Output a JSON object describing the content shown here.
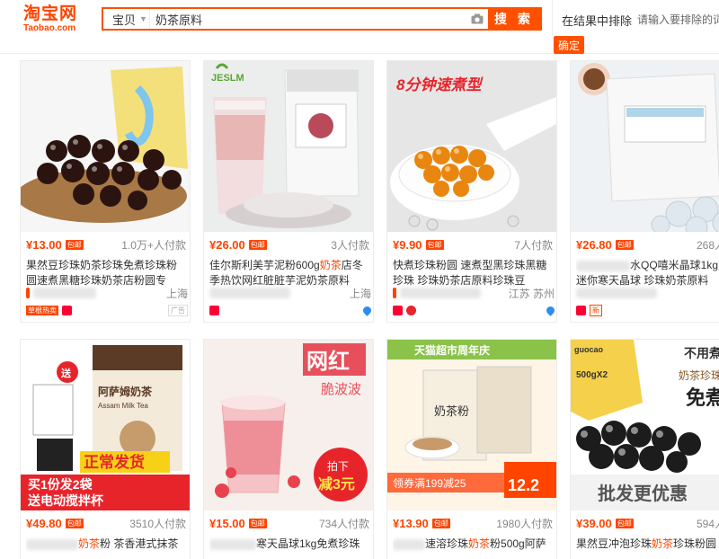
{
  "header": {
    "logo_cn": "淘宝网",
    "logo_en": "Taobao.com",
    "category_label": "宝贝",
    "search_value": "奶茶原料",
    "search_button": "搜 索",
    "exclude_label": "在结果中排除",
    "exclude_placeholder": "请输入要排除的词",
    "confirm_button": "确定"
  },
  "items": [
    {
      "price": "¥13.00",
      "baoyou": "包邮",
      "sales": "1.0万+人付款",
      "title_a": "果然豆珍珠奶茶珍珠免煮珍珠粉",
      "title_b": "圆速煮黑糖珍珠奶茶店粉圆专",
      "location": "上海",
      "tag": "草根热卖"
    },
    {
      "price": "¥26.00",
      "baoyou": "包邮",
      "sales": "3人付款",
      "title_a": "佳尔斯利美芋泥粉600g",
      "title_hl": "奶茶",
      "title_c": "店冬",
      "title_b": "季热饮网红脏脏芋泥奶茶原料",
      "location": "上海"
    },
    {
      "price": "¥9.90",
      "baoyou": "包邮",
      "sales": "7人付款",
      "title_a": "快煮珍珠粉圆 速煮型黑珍珠黑糖",
      "title_b": "珍珠 珍珠奶茶店原料珍珠豆",
      "location": "江苏 苏州",
      "image_text": "8分钟速煮型"
    },
    {
      "price": "¥26.80",
      "baoyou": "包邮",
      "sales": "268人付",
      "title_a": "水QQ嘻米晶球1kg",
      "title_b": "迷你寒天晶球 珍珠奶茶原料",
      "location": "上"
    },
    {
      "price": "¥49.80",
      "baoyou": "包邮",
      "sales": "3510人付款",
      "title_hl": "奶茶",
      "title_a": "粉 茶香港式抹茶",
      "location": "",
      "image_text_1": "阿萨姆奶茶",
      "image_text_2": "Assam Milk Tea",
      "image_text_3": "正常发货",
      "image_text_4": "买1份发2袋",
      "image_text_5": "送电动搅拌杯",
      "image_text_6": "送"
    },
    {
      "price": "¥15.00",
      "baoyou": "包邮",
      "sales": "734人付款",
      "title_a": "寒天晶球1kg免煮珍珠",
      "image_text_1": "网红",
      "image_text_2": "脆波波",
      "image_text_3": "拍下",
      "image_text_4": "减3元"
    },
    {
      "price": "¥13.90",
      "baoyou": "包邮",
      "sales": "1980人付款",
      "title_a": "速溶珍珠",
      "title_hl": "奶茶",
      "title_c": "粉500g阿萨",
      "image_text_1": "天猫超市周年庆",
      "image_text_2": "奶茶粉",
      "image_text_3": "领券满199减25",
      "image_text_4": "12.2"
    },
    {
      "price": "¥39.00",
      "baoyou": "包邮",
      "sales": "594人付",
      "title_a": "果然豆冲泡珍珠",
      "title_hl": "奶茶",
      "title_c": "珍珠粉圆",
      "image_text_1": "不用煮",
      "image_text_2": "免煮",
      "image_text_3": "奶茶珍珠",
      "image_text_4": "批发更优惠",
      "image_text_5": "500gX2"
    }
  ]
}
